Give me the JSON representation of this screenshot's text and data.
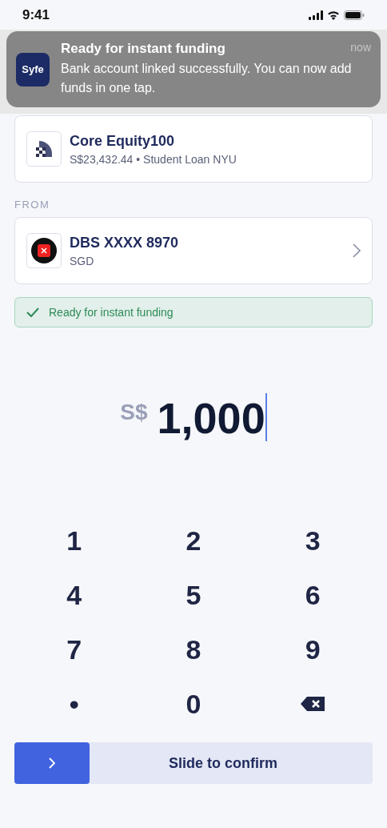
{
  "status_bar": {
    "time": "9:41"
  },
  "notification": {
    "app_icon_text": "Syfe",
    "title": "Ready for instant funding",
    "time": "now",
    "body": "Bank account linked successfully. You can now add funds in one tap."
  },
  "to_account": {
    "name": "Core Equity100",
    "detail": "S$23,432.44 • Student Loan NYU"
  },
  "from_label": "FROM",
  "from_account": {
    "name": "DBS XXXX 8970",
    "currency": "SGD"
  },
  "funding_status": {
    "text": "Ready for instant funding"
  },
  "amount": {
    "currency": "S$",
    "value": "1,000"
  },
  "keypad": [
    {
      "kind": "text",
      "label": "1"
    },
    {
      "kind": "text",
      "label": "2"
    },
    {
      "kind": "text",
      "label": "3"
    },
    {
      "kind": "text",
      "label": "4"
    },
    {
      "kind": "text",
      "label": "5"
    },
    {
      "kind": "text",
      "label": "6"
    },
    {
      "kind": "text",
      "label": "7"
    },
    {
      "kind": "text",
      "label": "8"
    },
    {
      "kind": "text",
      "label": "9"
    },
    {
      "kind": "text",
      "label": "•"
    },
    {
      "kind": "text",
      "label": "0"
    },
    {
      "kind": "backspace"
    }
  ],
  "slider": {
    "label": "Slide to confirm"
  }
}
